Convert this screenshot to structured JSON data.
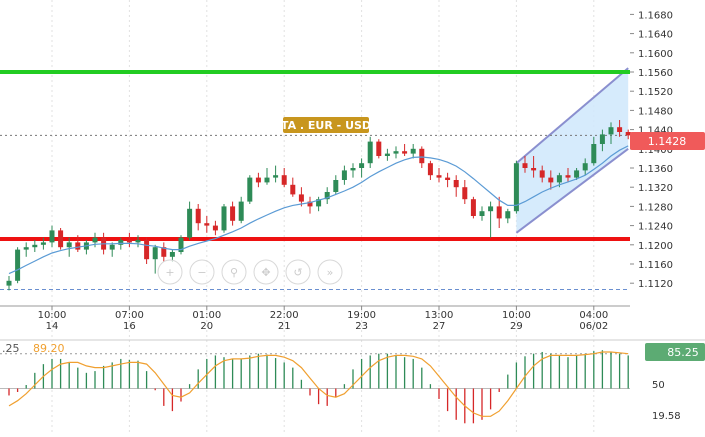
{
  "instrument_label": "TA . EUR - USD",
  "price_badge": "1.1428",
  "colors": {
    "bull": "#2e8b57",
    "bear": "#d62728",
    "ma": "#5b9bd5",
    "resistance": "#22cc22",
    "support": "#ee1111",
    "channel_fill": "#cfe8fb",
    "channel_line": "#8a8fcf",
    "badge": "#f05a5a",
    "label_bg": "#c8961e",
    "hist_bull": "#2e8b57",
    "hist_bear": "#d62728",
    "osc_line": "#f0a030",
    "osc_badge": "#5cab73"
  },
  "toolbar_icons": [
    "zoom-in-icon",
    "zoom-out-icon",
    "search-icon",
    "pan-icon",
    "reset-icon",
    "forward-icon"
  ],
  "chart_data": [
    {
      "type": "candlestick",
      "y_ticks": [
        "1.1680",
        "1.1640",
        "1.1600",
        "1.1560",
        "1.1520",
        "1.1480",
        "1.1440",
        "1.1400",
        "1.1360",
        "1.1320",
        "1.1280",
        "1.1240",
        "1.1200",
        "1.1160",
        "1.1120"
      ],
      "ylim": [
        1.1085,
        1.171
      ],
      "x_ticks": [
        {
          "index": 5,
          "time": "10:00",
          "date": "14"
        },
        {
          "index": 14,
          "time": "07:00",
          "date": "16"
        },
        {
          "index": 23,
          "time": "01:00",
          "date": "20"
        },
        {
          "index": 32,
          "time": "22:00",
          "date": "21"
        },
        {
          "index": 41,
          "time": "19:00",
          "date": "23"
        },
        {
          "index": 50,
          "time": "13:00",
          "date": "27"
        },
        {
          "index": 59,
          "time": "10:00",
          "date": "29"
        },
        {
          "index": 68,
          "time": "04:00",
          "date": "06/02"
        }
      ],
      "resistance": 1.156,
      "support": 1.1212,
      "dotted_level": 1.1428,
      "lower_dashed_level": 1.1107,
      "ohlc": [
        [
          1.1115,
          1.1135,
          1.1105,
          1.1125
        ],
        [
          1.1125,
          1.1195,
          1.112,
          1.119
        ],
        [
          1.119,
          1.1205,
          1.1175,
          1.1195
        ],
        [
          1.1195,
          1.121,
          1.1185,
          1.12
        ],
        [
          1.12,
          1.1215,
          1.119,
          1.1205
        ],
        [
          1.1205,
          1.124,
          1.1195,
          1.123
        ],
        [
          1.123,
          1.1235,
          1.119,
          1.1195
        ],
        [
          1.1195,
          1.1215,
          1.1175,
          1.1205
        ],
        [
          1.1205,
          1.122,
          1.1185,
          1.119
        ],
        [
          1.119,
          1.121,
          1.118,
          1.1205
        ],
        [
          1.1205,
          1.1225,
          1.1195,
          1.1215
        ],
        [
          1.1215,
          1.1225,
          1.118,
          1.119
        ],
        [
          1.119,
          1.1205,
          1.1175,
          1.12
        ],
        [
          1.12,
          1.1215,
          1.119,
          1.121
        ],
        [
          1.121,
          1.1225,
          1.1195,
          1.1205
        ],
        [
          1.1205,
          1.122,
          1.1195,
          1.121
        ],
        [
          1.121,
          1.1215,
          1.116,
          1.117
        ],
        [
          1.117,
          1.12,
          1.114,
          1.1195
        ],
        [
          1.1195,
          1.1205,
          1.1165,
          1.1175
        ],
        [
          1.1175,
          1.119,
          1.1165,
          1.1185
        ],
        [
          1.1185,
          1.122,
          1.118,
          1.1215
        ],
        [
          1.1215,
          1.129,
          1.121,
          1.1275
        ],
        [
          1.1275,
          1.1285,
          1.123,
          1.1245
        ],
        [
          1.1245,
          1.126,
          1.1225,
          1.124
        ],
        [
          1.124,
          1.125,
          1.122,
          1.123
        ],
        [
          1.123,
          1.1285,
          1.1225,
          1.128
        ],
        [
          1.128,
          1.129,
          1.124,
          1.125
        ],
        [
          1.125,
          1.13,
          1.1245,
          1.129
        ],
        [
          1.129,
          1.1345,
          1.1285,
          1.134
        ],
        [
          1.134,
          1.135,
          1.132,
          1.133
        ],
        [
          1.133,
          1.136,
          1.1325,
          1.134
        ],
        [
          1.134,
          1.1365,
          1.133,
          1.1345
        ],
        [
          1.1345,
          1.136,
          1.132,
          1.1325
        ],
        [
          1.1325,
          1.134,
          1.13,
          1.1305
        ],
        [
          1.1305,
          1.132,
          1.128,
          1.129
        ],
        [
          1.129,
          1.13,
          1.1265,
          1.128
        ],
        [
          1.128,
          1.13,
          1.127,
          1.1295
        ],
        [
          1.1295,
          1.132,
          1.1285,
          1.131
        ],
        [
          1.131,
          1.1345,
          1.1305,
          1.1335
        ],
        [
          1.1335,
          1.1365,
          1.1325,
          1.1355
        ],
        [
          1.1355,
          1.137,
          1.134,
          1.136
        ],
        [
          1.136,
          1.138,
          1.134,
          1.137
        ],
        [
          1.137,
          1.1425,
          1.136,
          1.1415
        ],
        [
          1.1415,
          1.142,
          1.138,
          1.1385
        ],
        [
          1.1385,
          1.14,
          1.1375,
          1.139
        ],
        [
          1.139,
          1.1405,
          1.138,
          1.1395
        ],
        [
          1.1395,
          1.141,
          1.1385,
          1.139
        ],
        [
          1.139,
          1.141,
          1.138,
          1.14
        ],
        [
          1.14,
          1.1405,
          1.136,
          1.137
        ],
        [
          1.137,
          1.1375,
          1.1335,
          1.1345
        ],
        [
          1.1345,
          1.136,
          1.133,
          1.134
        ],
        [
          1.134,
          1.135,
          1.132,
          1.1335
        ],
        [
          1.1335,
          1.1345,
          1.13,
          1.132
        ],
        [
          1.132,
          1.1335,
          1.1285,
          1.1295
        ],
        [
          1.1295,
          1.13,
          1.1255,
          1.126
        ],
        [
          1.126,
          1.128,
          1.125,
          1.127
        ],
        [
          1.127,
          1.129,
          1.1215,
          1.128
        ],
        [
          1.128,
          1.13,
          1.1235,
          1.1255
        ],
        [
          1.1255,
          1.1275,
          1.1245,
          1.127
        ],
        [
          1.127,
          1.1375,
          1.1265,
          1.137
        ],
        [
          1.137,
          1.1385,
          1.135,
          1.136
        ],
        [
          1.136,
          1.1385,
          1.134,
          1.1355
        ],
        [
          1.1355,
          1.1365,
          1.133,
          1.134
        ],
        [
          1.134,
          1.1355,
          1.1315,
          1.133
        ],
        [
          1.133,
          1.135,
          1.132,
          1.1345
        ],
        [
          1.1345,
          1.136,
          1.133,
          1.134
        ],
        [
          1.134,
          1.136,
          1.1335,
          1.1355
        ],
        [
          1.1355,
          1.138,
          1.1345,
          1.137
        ],
        [
          1.137,
          1.1425,
          1.1365,
          1.141
        ],
        [
          1.141,
          1.144,
          1.1395,
          1.143
        ],
        [
          1.143,
          1.1455,
          1.141,
          1.1445
        ],
        [
          1.1445,
          1.146,
          1.1425,
          1.1435
        ],
        [
          1.1435,
          1.144,
          1.142,
          1.1428
        ]
      ],
      "moving_average": [
        1.114,
        1.1148,
        1.1157,
        1.1166,
        1.1175,
        1.1183,
        1.1188,
        1.1192,
        1.1195,
        1.1198,
        1.1201,
        1.1202,
        1.1202,
        1.1203,
        1.1203,
        1.1202,
        1.1199,
        1.1197,
        1.1193,
        1.119,
        1.119,
        1.1197,
        1.1203,
        1.1208,
        1.1213,
        1.122,
        1.1227,
        1.1235,
        1.1245,
        1.1254,
        1.1262,
        1.127,
        1.1277,
        1.1282,
        1.1285,
        1.1288,
        1.1293,
        1.1298,
        1.1305,
        1.1312,
        1.132,
        1.133,
        1.1342,
        1.1352,
        1.1361,
        1.137,
        1.1377,
        1.1382,
        1.1383,
        1.1381,
        1.1378,
        1.1372,
        1.1364,
        1.1352,
        1.1338,
        1.1323,
        1.1308,
        1.1293,
        1.1282,
        1.1282,
        1.129,
        1.13,
        1.131,
        1.1318,
        1.1325,
        1.1331,
        1.1337,
        1.1345,
        1.1357,
        1.137,
        1.1385,
        1.1397,
        1.1406
      ],
      "channel": {
        "lower": [
          [
            59,
            1.1225
          ],
          [
            72,
            1.14
          ]
        ],
        "upper": [
          [
            59,
            1.137
          ],
          [
            72,
            1.1568
          ]
        ]
      }
    },
    {
      "type": "bar",
      "name": "oscillator",
      "header_values": [
        ".25",
        "89.20"
      ],
      "y_ticks": [
        "50",
        "19.58"
      ],
      "ylim": [
        0,
        100
      ],
      "current": "85.25",
      "values": [
        42,
        46,
        54,
        68,
        78,
        84,
        84,
        80,
        74,
        68,
        70,
        76,
        80,
        84,
        83,
        82,
        70,
        48,
        30,
        24,
        35,
        55,
        72,
        84,
        88,
        86,
        84,
        84,
        88,
        90,
        89,
        85,
        80,
        74,
        60,
        42,
        32,
        30,
        40,
        55,
        72,
        84,
        88,
        90,
        90,
        88,
        86,
        84,
        74,
        55,
        38,
        24,
        14,
        10,
        10,
        14,
        26,
        46,
        66,
        80,
        87,
        90,
        92,
        90,
        88,
        86,
        88,
        90,
        93,
        94,
        92,
        90,
        88
      ],
      "signal": [
        30,
        36,
        44,
        54,
        64,
        72,
        78,
        80,
        80,
        76,
        74,
        74,
        76,
        78,
        80,
        80,
        78,
        68,
        55,
        42,
        40,
        45,
        56,
        66,
        76,
        82,
        84,
        84,
        85,
        87,
        88,
        88,
        86,
        82,
        74,
        62,
        50,
        42,
        40,
        44,
        54,
        64,
        74,
        82,
        86,
        88,
        88,
        87,
        84,
        76,
        64,
        52,
        40,
        30,
        22,
        18,
        18,
        24,
        36,
        50,
        64,
        76,
        84,
        88,
        88,
        88,
        88,
        89,
        90,
        92,
        92,
        91,
        90
      ]
    }
  ]
}
